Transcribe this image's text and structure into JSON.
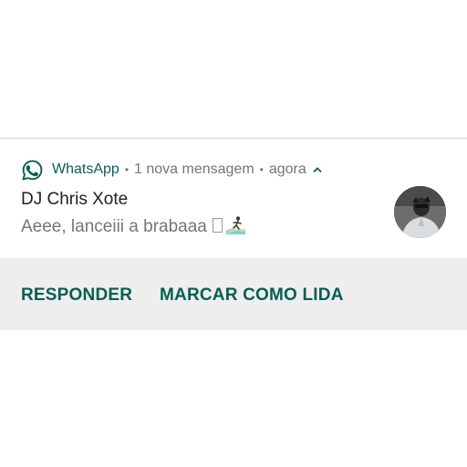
{
  "notification": {
    "app_name": "WhatsApp",
    "separator": "•",
    "summary": "1 nova mensagem",
    "time": "agora",
    "sender": "DJ Chris Xote",
    "message": "Aeee, lanceiii a brabaaa",
    "icons": {
      "app": "whatsapp-icon",
      "expand": "chevron-up-icon",
      "emoji_missing": "missing-glyph-box",
      "emoji": "surfer-emoji",
      "avatar": "contact-avatar"
    },
    "colors": {
      "accent": "#075e54",
      "whatsapp_green": "#075e54",
      "secondary_text": "#757575",
      "action_bar": "#eeeeee"
    }
  },
  "actions": {
    "reply_label": "RESPONDER",
    "mark_read_label": "MARCAR COMO LIDA"
  }
}
